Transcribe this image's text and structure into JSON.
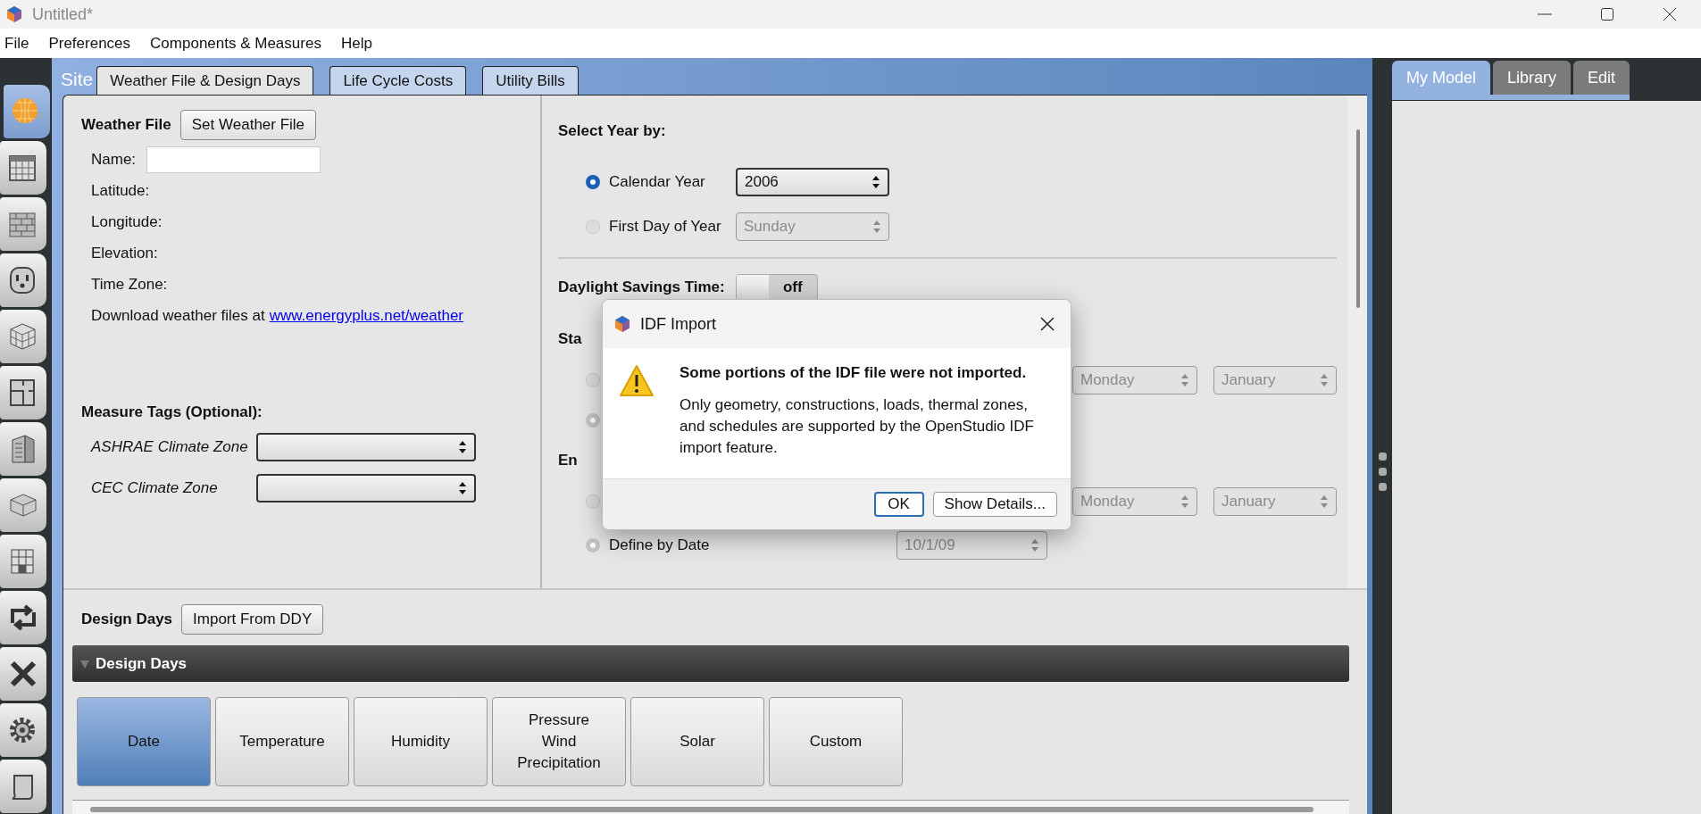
{
  "window": {
    "title": "Untitled*"
  },
  "menu": [
    "File",
    "Preferences",
    "Components & Measures",
    "Help"
  ],
  "sidebar": {
    "items": [
      {
        "kind": "globe",
        "selected": true
      },
      {
        "kind": "calendar",
        "selected": false
      },
      {
        "kind": "bricks",
        "selected": false
      },
      {
        "kind": "outlet",
        "selected": false
      },
      {
        "kind": "cube",
        "selected": false
      },
      {
        "kind": "floorplan",
        "selected": false
      },
      {
        "kind": "building",
        "selected": false
      },
      {
        "kind": "box",
        "selected": false
      },
      {
        "kind": "cubes",
        "selected": false
      },
      {
        "kind": "arrows",
        "selected": false
      },
      {
        "kind": "cross",
        "selected": false
      },
      {
        "kind": "gear",
        "selected": false
      },
      {
        "kind": "scroll",
        "selected": false
      }
    ]
  },
  "site": {
    "label": "Site",
    "tabs": [
      {
        "label": "Weather File & Design Days",
        "selected": true
      },
      {
        "label": "Life Cycle Costs",
        "selected": false
      },
      {
        "label": "Utility Bills",
        "selected": false
      }
    ]
  },
  "weather_file": {
    "heading": "Weather File",
    "button": "Set Weather File",
    "fields": [
      {
        "label": "Name:",
        "kind": "input"
      },
      {
        "label": "Latitude:",
        "kind": "text"
      },
      {
        "label": "Longitude:",
        "kind": "text"
      },
      {
        "label": "Elevation:",
        "kind": "text"
      },
      {
        "label": "Time Zone:",
        "kind": "text"
      }
    ],
    "download": {
      "text": "Download weather files at",
      "link": "www.energyplus.net/weather"
    }
  },
  "measure_tags": {
    "heading": "Measure Tags (Optional):",
    "fields": [
      {
        "label": "ASHRAE Climate Zone"
      },
      {
        "label": "CEC Climate Zone"
      }
    ]
  },
  "select_year": {
    "heading": "Select Year by:",
    "options": [
      {
        "label": "Calendar Year",
        "selected": true,
        "value": "2006",
        "disabled": false
      },
      {
        "label": "First Day of Year",
        "selected": false,
        "value": "Sunday",
        "disabled": true
      }
    ]
  },
  "daylight_savings": {
    "label": "Daylight Savings Time:",
    "on": false,
    "state_text": "off"
  },
  "start": {
    "heading": "Sta",
    "rows": [
      {
        "selected": false,
        "day": "Monday",
        "month": "January"
      },
      {
        "selected": true
      }
    ]
  },
  "end": {
    "heading": "En",
    "rows": [
      {
        "selected": false,
        "day": "Monday",
        "month": "January"
      },
      {
        "selected": true,
        "label": "Define by Date",
        "date": "10/1/09"
      }
    ]
  },
  "design_days": {
    "label": "Design Days",
    "button": "Import From DDY",
    "section": {
      "title": "Design Days",
      "expanded": true
    },
    "tabs": [
      {
        "label": "Date",
        "selected": true
      },
      {
        "label": "Temperature",
        "selected": false
      },
      {
        "label": "Humidity",
        "selected": false
      },
      {
        "label": "Pressure\nWind\nPrecipitation",
        "selected": false
      },
      {
        "label": "Solar",
        "selected": false
      },
      {
        "label": "Custom",
        "selected": false
      }
    ]
  },
  "right_panel": {
    "tabs": [
      {
        "label": "My Model",
        "selected": true
      },
      {
        "label": "Library",
        "selected": false
      },
      {
        "label": "Edit",
        "selected": false
      }
    ]
  },
  "dialog": {
    "title": "IDF Import",
    "heading": "Some portions of the IDF file were not imported.",
    "message": "Only geometry, constructions, loads, thermal zones, and schedules are supported by the OpenStudio IDF import feature.",
    "buttons": [
      {
        "label": "OK",
        "kind": "default"
      },
      {
        "label": "Show Details...",
        "kind": "normal"
      }
    ]
  }
}
